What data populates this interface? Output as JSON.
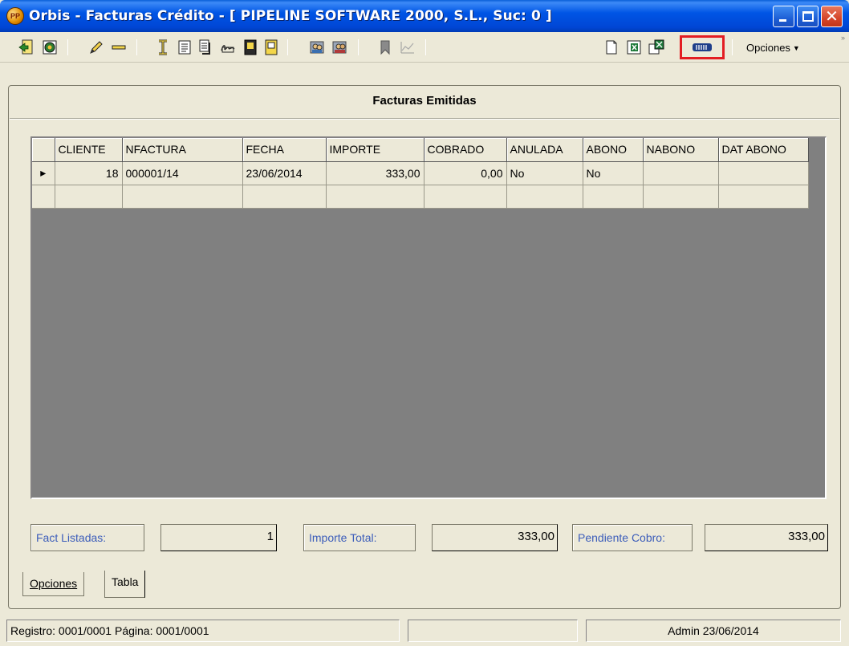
{
  "window": {
    "title": "Orbis - Facturas Crédito - [ PIPELINE SOFTWARE 2000, S.L., Suc: 0 ]"
  },
  "toolbar": {
    "opciones_label": "Opciones"
  },
  "panel": {
    "title": "Facturas Emitidas"
  },
  "table": {
    "columns": [
      "CLIENTE",
      "NFACTURA",
      "FECHA",
      "IMPORTE",
      "COBRADO",
      "ANULADA",
      "ABONO",
      "NABONO",
      "DAT ABONO"
    ],
    "rows": [
      [
        "18",
        "000001/14",
        "23/06/2014",
        "333,00",
        "0,00",
        "No",
        "No",
        "",
        ""
      ]
    ],
    "current_row_marker": "▸"
  },
  "summary": {
    "fact_listadas_label": "Fact Listadas:",
    "fact_listadas_value": "1",
    "importe_total_label": "Importe Total:",
    "importe_total_value": "333,00",
    "pendiente_cobro_label": "Pendiente Cobro:",
    "pendiente_cobro_value": "333,00"
  },
  "tabs": {
    "opciones": "Opciones",
    "tabla": "Tabla"
  },
  "status": {
    "registro": "Registro: 0001/0001  Página: 0001/0001",
    "middle": "",
    "user_date": "Admin 23/06/2014"
  }
}
